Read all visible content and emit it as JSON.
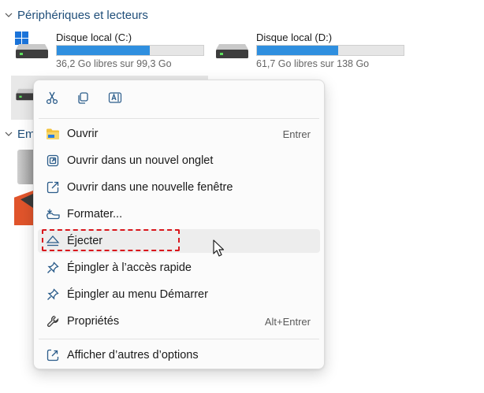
{
  "sections": {
    "devices_header": "Périphériques et lecteurs",
    "other_header": "Em"
  },
  "drives": [
    {
      "name": "Disque local (C:)",
      "size_text": "36,2 Go libres sur 99,3 Go",
      "used_fraction": 0.635,
      "icon": "windows-drive-icon"
    },
    {
      "name": "Disque local (D:)",
      "size_text": "61,7 Go libres sur 138 Go",
      "used_fraction": 0.553,
      "icon": "hard-drive-icon"
    }
  ],
  "menu": {
    "toolbar": [
      {
        "name": "cut",
        "icon": "scissors-icon"
      },
      {
        "name": "copy",
        "icon": "copy-icon"
      },
      {
        "name": "rename",
        "icon": "rename-icon"
      }
    ],
    "items": [
      {
        "label": "Ouvrir",
        "shortcut": "Entrer",
        "icon": "folder-icon"
      },
      {
        "label": "Ouvrir dans un nouvel onglet",
        "shortcut": "",
        "icon": "new-tab-icon"
      },
      {
        "label": "Ouvrir dans une nouvelle fenêtre",
        "shortcut": "",
        "icon": "new-window-icon"
      },
      {
        "label": "Formater...",
        "shortcut": "",
        "icon": "format-icon"
      },
      {
        "label": "Éjecter",
        "shortcut": "",
        "icon": "eject-icon"
      },
      {
        "label": "Épingler à l’accès rapide",
        "shortcut": "",
        "icon": "pin-icon"
      },
      {
        "label": "Épingler au menu Démarrer",
        "shortcut": "",
        "icon": "pin-start-icon"
      },
      {
        "label": "Propriétés",
        "shortcut": "Alt+Entrer",
        "icon": "wrench-icon"
      },
      {
        "label": "Afficher d’autres d’options",
        "shortcut": "",
        "icon": "more-options-icon"
      }
    ]
  },
  "colors": {
    "accent": "#2f8fdf",
    "highlight": "#d9161c",
    "section_header": "#1f4e79"
  }
}
